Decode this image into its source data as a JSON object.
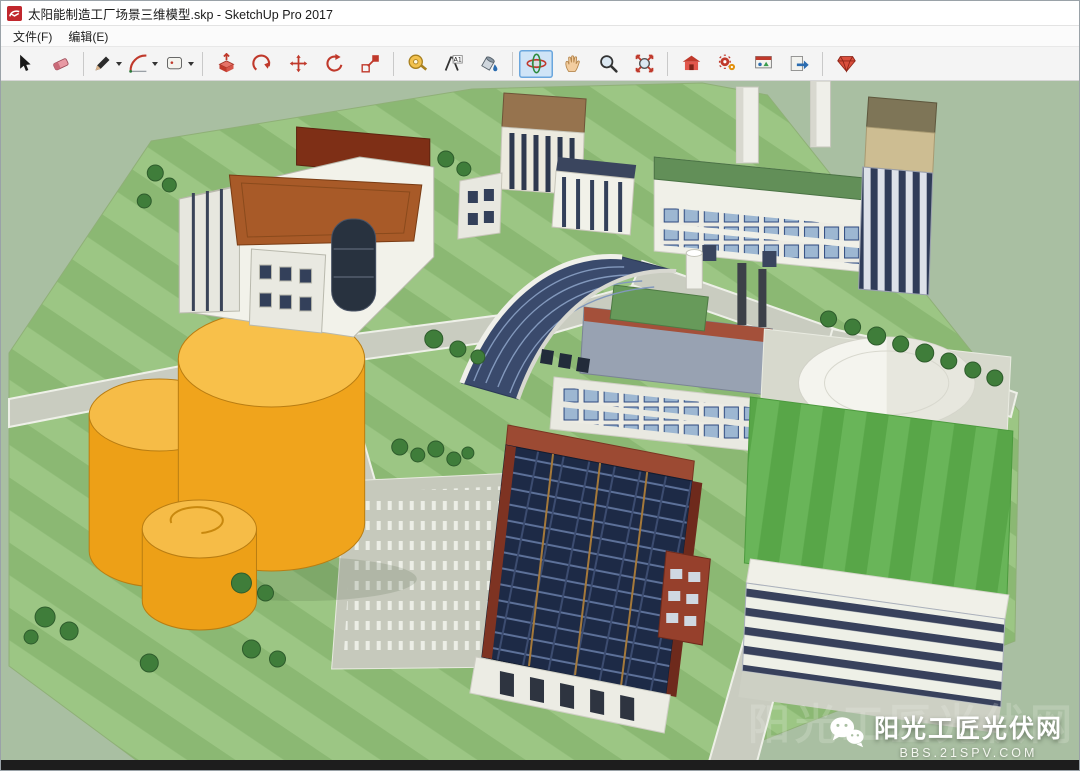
{
  "window": {
    "title": "太阳能制造工厂场景三维模型.skp - SketchUp Pro 2017"
  },
  "menu": {
    "items": [
      {
        "label": "文件(F)"
      },
      {
        "label": "编辑(E)"
      }
    ]
  },
  "toolbar": {
    "tools": [
      {
        "name": "select-tool",
        "icon": "select"
      },
      {
        "name": "eraser-tool",
        "icon": "eraser"
      },
      {
        "separator": true
      },
      {
        "name": "line-tool",
        "icon": "pencil",
        "dropdown": true
      },
      {
        "name": "arc-tool",
        "icon": "arc",
        "dropdown": true
      },
      {
        "name": "shapes-tool",
        "icon": "shapes",
        "dropdown": true
      },
      {
        "separator": true
      },
      {
        "name": "push-pull-tool",
        "icon": "pushpull"
      },
      {
        "name": "offset-tool",
        "icon": "offset"
      },
      {
        "name": "move-tool",
        "icon": "move"
      },
      {
        "name": "rotate-tool",
        "icon": "rotate"
      },
      {
        "name": "scale-tool",
        "icon": "scale"
      },
      {
        "separator": true
      },
      {
        "name": "tape-measure-tool",
        "icon": "tape"
      },
      {
        "name": "text-tool",
        "icon": "text"
      },
      {
        "name": "paint-bucket-tool",
        "icon": "paint"
      },
      {
        "separator": true
      },
      {
        "name": "orbit-tool",
        "icon": "orbit",
        "selected": true
      },
      {
        "name": "pan-tool",
        "icon": "pan"
      },
      {
        "name": "zoom-tool",
        "icon": "zoom"
      },
      {
        "name": "zoom-extents-tool",
        "icon": "zoomext"
      },
      {
        "separator": true
      },
      {
        "name": "warehouse-3d-button",
        "icon": "warehouse"
      },
      {
        "name": "extension-warehouse-button",
        "icon": "gears"
      },
      {
        "name": "styles-button",
        "icon": "styles"
      },
      {
        "name": "share-model-button",
        "icon": "share"
      },
      {
        "separator": true
      },
      {
        "name": "extension-manager-button",
        "icon": "gem"
      }
    ]
  },
  "watermark": {
    "title": "阳光工匠光伏网",
    "subtitle": "BBS.21SPV.COM"
  },
  "colors": {
    "viewport_background": "#a9bfa2",
    "selected_tool_highlight": "#cfe4f7",
    "tank_orange": "#f0a41c",
    "solar_panel_navy": "#1d2a46",
    "lawn_green": "#8bb873",
    "bright_lawn_green": "#58a648"
  }
}
